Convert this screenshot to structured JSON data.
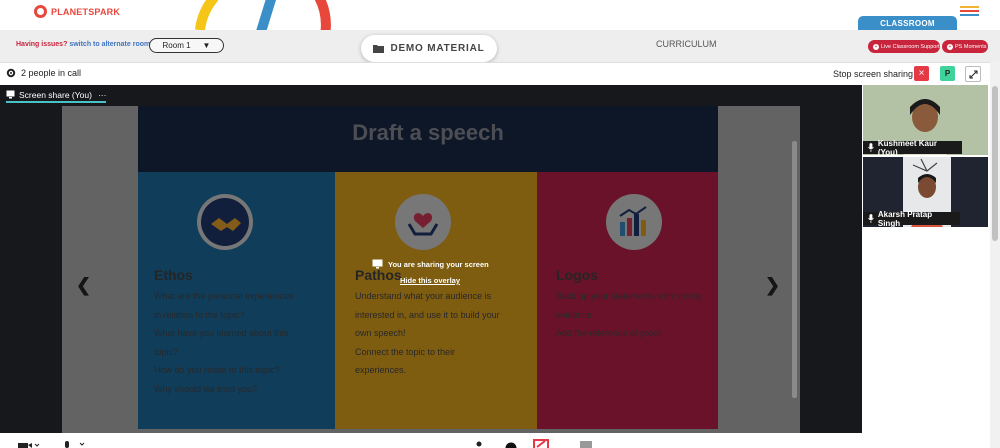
{
  "brand": {
    "logo_text": "PLANETSPARK"
  },
  "header": {
    "issues_prefix": "Having issues?",
    "issues_link": "switch to alternate room",
    "room_value": "Room 1",
    "demo_material_label": "DEMO MATERIAL",
    "curriculum_label": "CURRICULUM",
    "classroom_label": "CLASSROOM",
    "live_support_label": "Live Classroom Support",
    "ps_moments_label": "PS Moments"
  },
  "call_bar": {
    "people_text": "2 people in call",
    "stop_sharing_label": "Stop screen sharing",
    "stop_icon": "×",
    "avatar_initial": "P"
  },
  "stage": {
    "share_tab_label": "Screen share (You)",
    "share_tab_more": "···",
    "sharing_message": "You are sharing your screen",
    "hide_overlay_label": "Hide this overlay"
  },
  "slide": {
    "title": "Draft a speech",
    "columns": [
      {
        "title": "Ethos",
        "lines": [
          "What are the personal experiences",
          "in relation to the topic?",
          "What have you learned about this",
          "topic?",
          "How do you relate to this topic?",
          "Why should we trust you?"
        ]
      },
      {
        "title": "Pathos",
        "lines": [
          "Understand what your audience is",
          "interested in, and use it to build your",
          "own speech!",
          "Connect the topic to their",
          "experiences."
        ]
      },
      {
        "title": "Logos",
        "lines": [
          "Back up your statements with strong",
          "evidence.",
          "Add the reference of proof."
        ]
      }
    ]
  },
  "participants": [
    {
      "name": "Kushmeet Kaur (You)"
    },
    {
      "name": "Akarsh Pratap Singh"
    }
  ],
  "colors": {
    "brand_red": "#c8243c",
    "classroom_blue": "#3a8fc9",
    "accent_teal": "#49c2c7",
    "ethos_blue": "#1d6fa5",
    "pathos_yellow": "#e6a81e",
    "logos_red": "#c4224f"
  }
}
